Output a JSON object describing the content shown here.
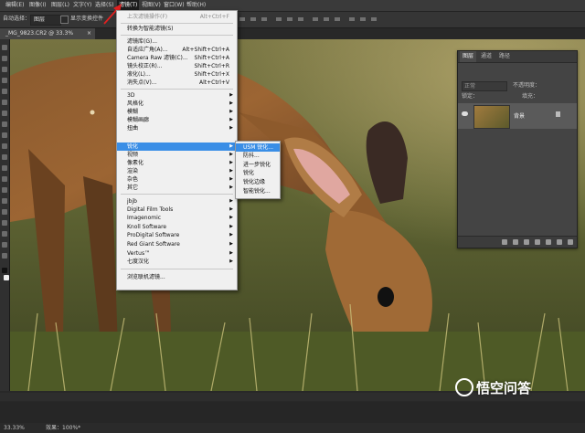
{
  "menubar": {
    "items": [
      "编辑(E)",
      "图像(I)",
      "图层(L)",
      "文字(Y)",
      "选择(S)",
      "滤镜(T)",
      "视图(V)",
      "窗口(W)",
      "帮助(H)"
    ]
  },
  "optionsbar": {
    "auto_select_label": "自动选择：",
    "auto_select_value": "图层",
    "show_transform_label": "显示变换控件"
  },
  "document": {
    "tab_title": "_MG_9823.CR2 @ 33.3%(RGB/8*)",
    "close": "×"
  },
  "statusbar": {
    "zoom": "33.33%",
    "doc_info": "效果：100%*"
  },
  "watermark": "悟空问答",
  "layers_panel": {
    "tabs": [
      "图层",
      "通道",
      "路径"
    ],
    "kind_label": "正常",
    "opacity_label": "不透明度：",
    "lock_label": "锁定：",
    "fill_label": "填充：",
    "layer_name": "背景"
  },
  "filter_menu": {
    "items": [
      {
        "label": "上次滤镜操作(F)",
        "shortcut": "Alt+Ctrl+F",
        "disabled": true
      },
      {
        "label": "转换为智能滤镜(S)"
      },
      {
        "label": "滤镜库(G)..."
      },
      {
        "label": "自适应广角(A)...",
        "shortcut": "Alt+Shift+Ctrl+A"
      },
      {
        "label": "Camera Raw 滤镜(C)...",
        "shortcut": "Shift+Ctrl+A"
      },
      {
        "label": "镜头校正(R)...",
        "shortcut": "Shift+Ctrl+R"
      },
      {
        "label": "液化(L)...",
        "shortcut": "Shift+Ctrl+X"
      },
      {
        "label": "消失点(V)...",
        "shortcut": "Alt+Ctrl+V"
      },
      {
        "label": "3D",
        "submenu": true
      },
      {
        "label": "风格化",
        "submenu": true
      },
      {
        "label": "模糊",
        "submenu": true
      },
      {
        "label": "模糊画廊",
        "submenu": true
      },
      {
        "label": "扭曲",
        "submenu": true
      },
      {
        "label": "锐化",
        "submenu": true,
        "highlight": true
      },
      {
        "label": "视频",
        "submenu": true
      },
      {
        "label": "像素化",
        "submenu": true
      },
      {
        "label": "渲染",
        "submenu": true
      },
      {
        "label": "杂色",
        "submenu": true
      },
      {
        "label": "其它",
        "submenu": true
      },
      {
        "label": "jbjb",
        "submenu": true
      },
      {
        "label": "Digital Film Tools",
        "submenu": true
      },
      {
        "label": "Imagenomic",
        "submenu": true
      },
      {
        "label": "Knoll Software",
        "submenu": true
      },
      {
        "label": "ProDigital Software",
        "submenu": true
      },
      {
        "label": "Red Giant Software",
        "submenu": true
      },
      {
        "label": "Vertus™",
        "submenu": true
      },
      {
        "label": "七度汉化",
        "submenu": true
      },
      {
        "label": "浏览联机滤镜..."
      }
    ]
  },
  "sharpen_submenu": {
    "items": [
      "USM 锐化...",
      "防抖...",
      "进一步锐化",
      "锐化",
      "锐化边缘",
      "智能锐化..."
    ]
  },
  "colors": {
    "highlight": "#3a8ee6",
    "arrow": "#e02020"
  }
}
